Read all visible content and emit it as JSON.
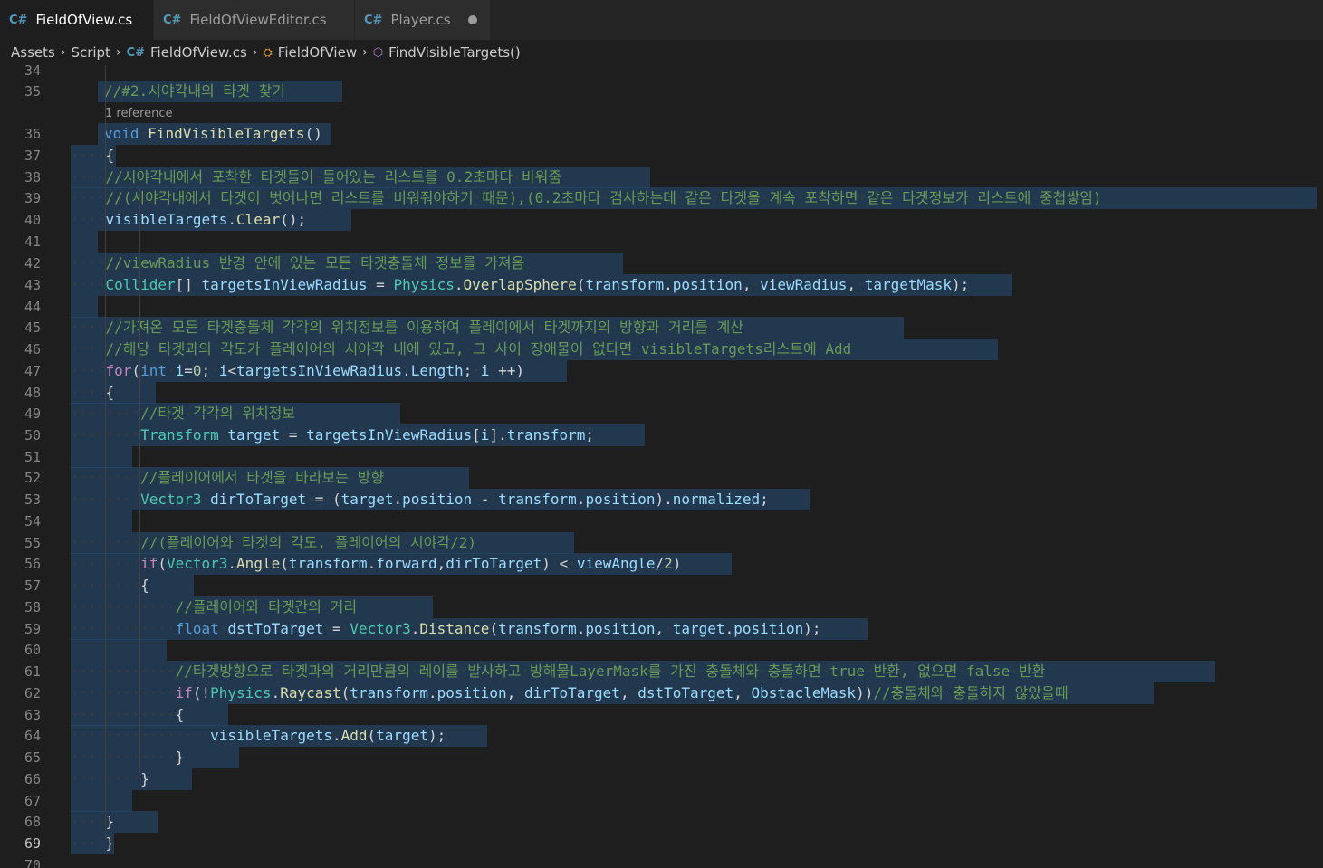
{
  "tabs": [
    {
      "label": "FieldOfView.cs",
      "icon": "csharp-file-icon",
      "active": true,
      "modified": true
    },
    {
      "label": "FieldOfViewEditor.cs",
      "icon": "csharp-file-icon",
      "active": false,
      "modified": false
    },
    {
      "label": "Player.cs",
      "icon": "csharp-file-icon",
      "active": false,
      "modified": true
    }
  ],
  "breadcrumb": [
    "Assets",
    "Script",
    "FieldOfView.cs",
    "FieldOfView",
    "FindVisibleTargets()"
  ],
  "codelens": "1 reference",
  "current_line": 69,
  "lines": [
    {
      "n": 34,
      "text": ""
    },
    {
      "n": 35,
      "text": "//#2.시야각내의 타겟 찾기"
    },
    {
      "n": 36,
      "text": "void FindVisibleTargets()"
    },
    {
      "n": 37,
      "text": "{"
    },
    {
      "n": 38,
      "text": "//시야각내에서 포착한 타겟들이 들어있는 리스트를 0.2초마다 비워줌"
    },
    {
      "n": 39,
      "text": "//(시야각내에서 타겟이 벗어나면 리스트를 비워줘야하기 때문),(0.2초마다 검사하는데 같은 타겟을 계속 포착하면 같은 타겟정보가 리스트에 중첩쌓임)"
    },
    {
      "n": 40,
      "text": "visibleTargets.Clear();"
    },
    {
      "n": 41,
      "text": ""
    },
    {
      "n": 42,
      "text": "//viewRadius 반경 안에 있는 모든 타겟충돌체 정보를 가져옴"
    },
    {
      "n": 43,
      "text": "Collider[] targetsInViewRadius = Physics.OverlapSphere(transform.position, viewRadius, targetMask);"
    },
    {
      "n": 44,
      "text": ""
    },
    {
      "n": 45,
      "text": "//가져온 모든 타겟충돌체 각각의 위치정보를 이용하여 플레이에서 타겟까지의 방향과 거리를 계산"
    },
    {
      "n": 46,
      "text": "//해당 타겟과의 각도가 플레이어의 시야각 내에 있고, 그 사이 장애물이 없다면 visibleTargets리스트에 Add"
    },
    {
      "n": 47,
      "text": "for(int i=0; i<targetsInViewRadius.Length; i ++)"
    },
    {
      "n": 48,
      "text": "{"
    },
    {
      "n": 49,
      "text": "//타겟 각각의 위치정보"
    },
    {
      "n": 50,
      "text": "Transform target = targetsInViewRadius[i].transform;"
    },
    {
      "n": 51,
      "text": ""
    },
    {
      "n": 52,
      "text": "//플레이어에서 타겟을 바라보는 방향"
    },
    {
      "n": 53,
      "text": "Vector3 dirToTarget = (target.position - transform.position).normalized;"
    },
    {
      "n": 54,
      "text": ""
    },
    {
      "n": 55,
      "text": "//(플레이어와 타겟의 각도, 플레이어의 시야각/2)"
    },
    {
      "n": 56,
      "text": "if(Vector3.Angle(transform.forward,dirToTarget) < viewAngle/2)"
    },
    {
      "n": 57,
      "text": "{"
    },
    {
      "n": 58,
      "text": "//플레이어와 타겟간의 거리"
    },
    {
      "n": 59,
      "text": "float dstToTarget = Vector3.Distance(transform.position, target.position);"
    },
    {
      "n": 60,
      "text": ""
    },
    {
      "n": 61,
      "text": "//타겟방향으로 타겟과의 거리만큼의 레이를 발사하고 방해물LayerMask를 가진 충돌체와 충돌하면 true 반환, 없으면 false 반환"
    },
    {
      "n": 62,
      "text": "if(!Physics.Raycast(transform.position, dirToTarget, dstToTarget, ObstacleMask))//충돌체와 충돌하지 않았을때"
    },
    {
      "n": 63,
      "text": "{"
    },
    {
      "n": 64,
      "text": "visibleTargets.Add(target);"
    },
    {
      "n": 65,
      "text": "}"
    },
    {
      "n": 66,
      "text": "}"
    },
    {
      "n": 67,
      "text": ""
    },
    {
      "n": 68,
      "text": "}"
    },
    {
      "n": 69,
      "text": "}"
    },
    {
      "n": 70,
      "text": ""
    }
  ]
}
